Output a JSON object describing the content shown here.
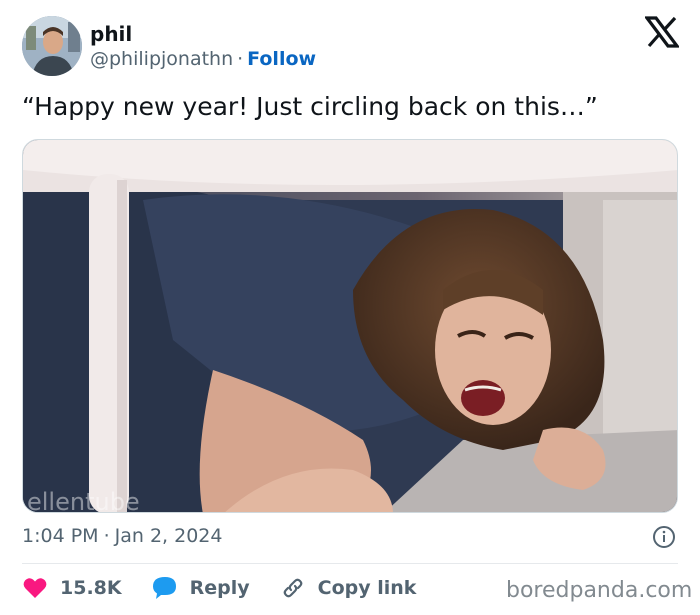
{
  "user": {
    "name": "phil",
    "handle": "@philipjonathn",
    "separator": "·",
    "follow_label": "Follow"
  },
  "tweet": {
    "text": "“Happy new year! Just circling back on this…”"
  },
  "media": {
    "alt_watermark": "ellentube"
  },
  "meta": {
    "time": "1:04 PM",
    "separator": "·",
    "date": "Jan 2, 2024"
  },
  "actions": {
    "likes": "15.8K",
    "reply_label": "Reply",
    "copy_link_label": "Copy link"
  },
  "site_watermark": "boredpanda.com",
  "colors": {
    "link_blue": "#0a66c2",
    "heart_red": "#f91880",
    "reply_blue": "#1d9bf0",
    "muted_text": "#536471"
  },
  "icons": {
    "logo": "x-logo-icon",
    "info": "info-icon",
    "like": "heart-icon",
    "reply": "reply-bubble-icon",
    "copy_link": "link-icon"
  }
}
